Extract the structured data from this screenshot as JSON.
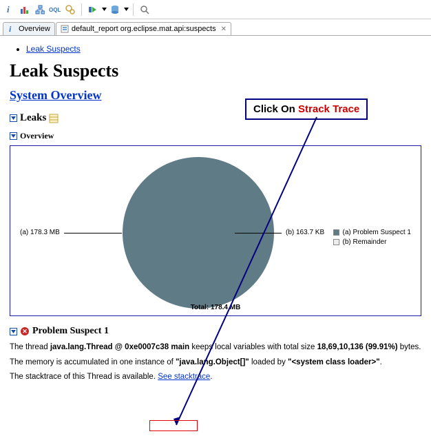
{
  "toolbar": {
    "info": "i",
    "chart": "bar-chart",
    "tree": "tree",
    "oql": "OQL",
    "gears": "gears",
    "run": "run",
    "db": "db",
    "search": "search"
  },
  "tabs": {
    "tab1": {
      "icon": "i",
      "label": "Overview"
    },
    "tab2": {
      "icon": "report",
      "label": "default_report  org.eclipse.mat.api:suspects"
    }
  },
  "breadcrumb": {
    "link": "Leak Suspects"
  },
  "page_title": "Leak Suspects",
  "system_overview_link": "System Overview",
  "leaks_header": "Leaks",
  "overview_subheader": "Overview",
  "callout": {
    "pre": "Click On ",
    "strong": "Strack Trace"
  },
  "chart_data": {
    "type": "pie",
    "title": "",
    "total_label": "Total: 178.4 MB",
    "series": [
      {
        "name": "(a)  Problem Suspect 1",
        "label": "(a)  178.3 MB",
        "value_mb": 178.3,
        "color": "#5f7b86"
      },
      {
        "name": "(b)  Remainder",
        "label": "(b)  163.7 KB",
        "value_mb": 0.16,
        "color": "#eeeeee"
      }
    ]
  },
  "problem": {
    "header": "Problem Suspect 1",
    "p1_pre": "The thread ",
    "p1_bold1": "java.lang.Thread @ 0xe0007c38 main",
    "p1_mid": " keeps local variables with total size ",
    "p1_bold2": "18,69,10,136 (99.91%)",
    "p1_post": " bytes.",
    "p2_pre": "The memory is accumulated in one instance of ",
    "p2_bold1": "\"java.lang.Object[]\"",
    "p2_mid": " loaded by ",
    "p2_bold2": "\"<system class loader>\"",
    "p2_post": ".",
    "p3_pre": "The stacktrace of this Thread is available. ",
    "p3_link": "See stacktrace",
    "p3_post": "."
  }
}
